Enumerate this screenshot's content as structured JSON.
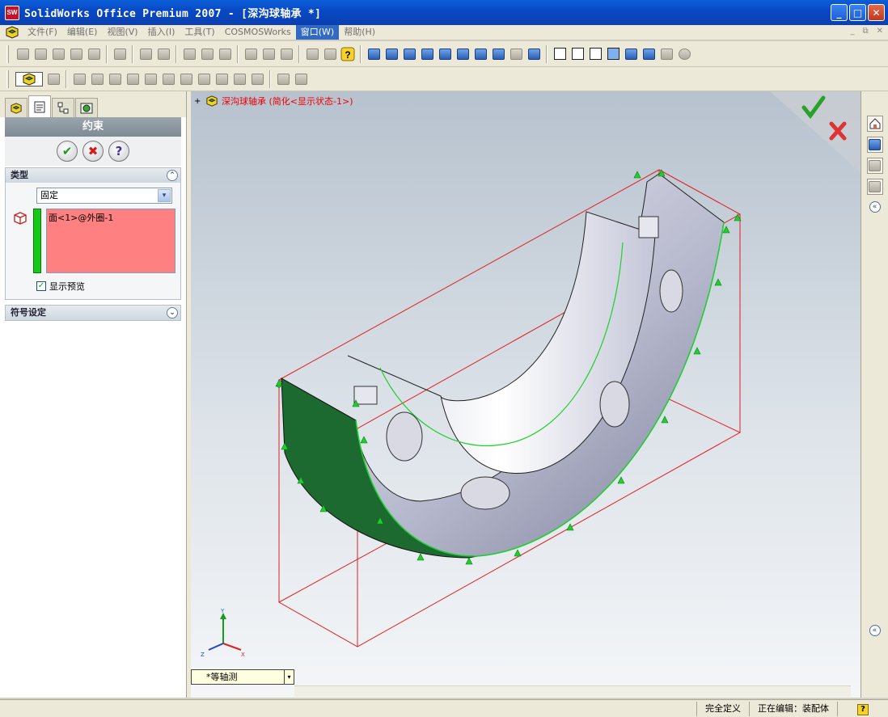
{
  "window": {
    "title": "SolidWorks Office Premium 2007 - [深沟球轴承 *]",
    "app_icon_text": "SW",
    "minimize": "_",
    "maximize": "□",
    "close": "✕"
  },
  "menubar": {
    "items": [
      "文件(F)",
      "编辑(E)",
      "视图(V)",
      "插入(I)",
      "工具(T)",
      "COSMOSWorks",
      "窗口(W)",
      "帮助(H)"
    ],
    "active": "窗口(W)",
    "mdi": [
      "_",
      "⧉",
      "✕"
    ]
  },
  "property_manager": {
    "title": "约束",
    "ok": "✔",
    "cancel": "✖",
    "help": "?",
    "type_group": {
      "label": "类型",
      "chevron": "⌃",
      "selected": "固定",
      "dropdown_arrow": "▾",
      "selection_items": [
        "面<1>@外圈-1"
      ],
      "show_preview_label": "显示预览",
      "show_preview_checked": "✓"
    },
    "symbol_group": {
      "label": "符号设定",
      "chevron": "⌄"
    }
  },
  "viewport": {
    "tree_expand": "+",
    "tree_label": "深沟球轴承  (简化<显示状态-1>)",
    "triad": {
      "x": "X",
      "y": "Y",
      "z": "Z"
    }
  },
  "view_orientation": {
    "value": "*等轴测",
    "dropdown_arrow": "▾"
  },
  "rightstrip": {
    "expand_top": "«",
    "expand_bottom": "«"
  },
  "statusbar": {
    "definition": "完全定义",
    "editing": "正在编辑：装配体",
    "help": "?"
  },
  "colors": {
    "title_blue": "#0a4fd0",
    "selection_pink": "#ff8080",
    "selection_bar_green": "#16c916",
    "restraint_green": "#1bd12b",
    "bbox_red": "#e02020"
  }
}
